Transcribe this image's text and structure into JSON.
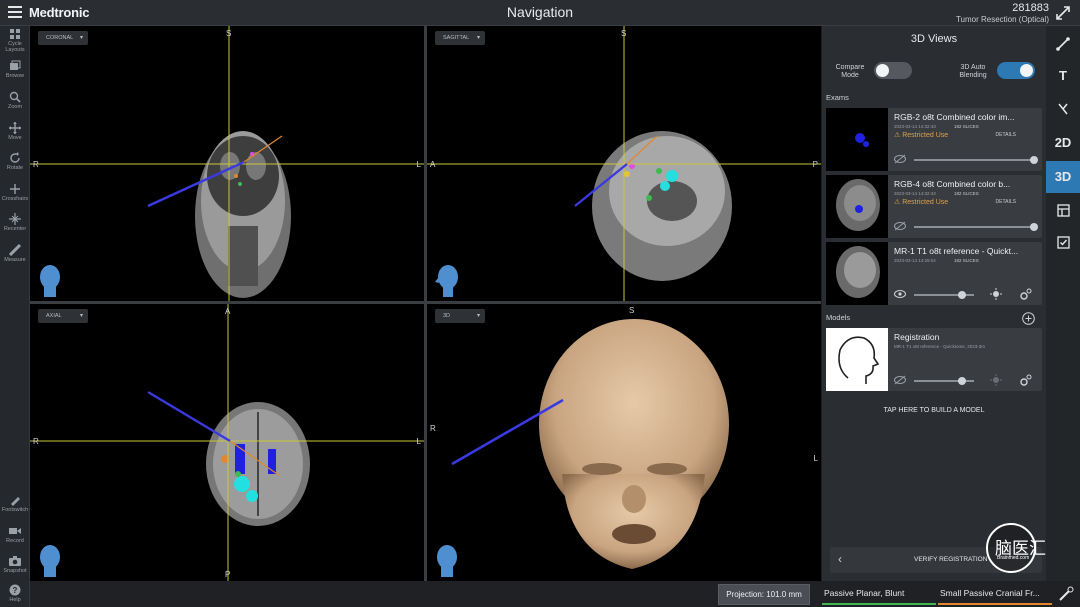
{
  "header": {
    "brand": "Medtronic",
    "title": "Navigation",
    "case_id": "281883",
    "case_name": "Tumor Resection (Optical)"
  },
  "left_tools": [
    {
      "label": "Cycle Layouts",
      "icon": "layout-icon"
    },
    {
      "label": "Browse",
      "icon": "stack-icon"
    },
    {
      "label": "Zoom",
      "icon": "zoom-icon"
    },
    {
      "label": "Move",
      "icon": "move-icon"
    },
    {
      "label": "Rotate",
      "icon": "rotate-icon"
    },
    {
      "label": "Crosshairs",
      "icon": "crosshair-icon"
    },
    {
      "label": "Recenter",
      "icon": "recenter-icon"
    },
    {
      "label": "Measure",
      "icon": "measure-icon"
    },
    {
      "label": "Footswitch",
      "icon": "footswitch-icon"
    },
    {
      "label": "Record",
      "icon": "record-icon"
    },
    {
      "label": "Snapshot",
      "icon": "camera-icon"
    },
    {
      "label": "Help",
      "icon": "help-icon"
    }
  ],
  "viewports": {
    "coronal": {
      "label": "CORONAL",
      "left": "R",
      "right": "L",
      "top": "S",
      "bottom": ""
    },
    "sagittal": {
      "label": "SAGITTAL",
      "left": "A",
      "right": "P",
      "top": "S",
      "bottom": ""
    },
    "axial": {
      "label": "AXIAL",
      "left": "R",
      "right": "L",
      "top": "A",
      "bottom": "P"
    },
    "view3d": {
      "label": "3D",
      "left": "R",
      "right": "L",
      "top": "S"
    }
  },
  "panel": {
    "title": "3D Views",
    "compare_mode_label": "Compare Mode",
    "compare_mode_on": false,
    "auto_blending_label": "3D Auto Blending",
    "auto_blending_on": true,
    "exams_heading": "Exams",
    "exams": [
      {
        "title": "RGB-2 o8t Combined color im...",
        "date": "2023-03-14 14:32:43",
        "slices": "182 SLICES",
        "warning": "Restricted Use",
        "details": "DETAILS",
        "level": 1.0
      },
      {
        "title": "RGB-4 o8t Combined color b...",
        "date": "2023-03-14 14:32:43",
        "slices": "182 SLICES",
        "warning": "Restricted Use",
        "details": "DETAILS",
        "level": 1.0
      },
      {
        "title": "MR-1 T1 o8t reference - Quickt...",
        "date": "2023-03-14 14:29:04",
        "slices": "182 SLICES",
        "warning": "",
        "details": "",
        "level": 0.8
      }
    ],
    "models_heading": "Models",
    "models": [
      {
        "title": "Registration",
        "subtitle": "MR-1 T1 o8t reference - Quicktome, 2023-3m",
        "level": 0.8
      }
    ],
    "build_model": "TAP HERE TO BUILD A MODEL",
    "verify_label": "VERIFY REGISTRATION"
  },
  "right_sidebar": [
    {
      "name": "expand-icon",
      "label": ""
    },
    {
      "name": "trajectory-icon",
      "label": ""
    },
    {
      "name": "text-icon",
      "label": "T"
    },
    {
      "name": "tool-tip-icon",
      "label": ""
    },
    {
      "name": "2d-button",
      "label": "2D"
    },
    {
      "name": "3d-button",
      "label": "3D"
    },
    {
      "name": "layout-panel-icon",
      "label": ""
    },
    {
      "name": "checklist-icon",
      "label": ""
    }
  ],
  "footer": {
    "projection": "Projection: 101.0 mm",
    "instrument1": "Passive Planar, Blunt",
    "instrument1_color": "#3fb950",
    "instrument2": "Small Passive Cranial Fr...",
    "instrument2_color": "#e0872f"
  },
  "watermark": {
    "text": "脑医汇",
    "sub": "Brainmed.com"
  },
  "colors": {
    "accent": "#2c79b3",
    "crosshair": "#c8c83a",
    "trajectory": "#3a3ae0",
    "warning": "#e0a24a"
  }
}
